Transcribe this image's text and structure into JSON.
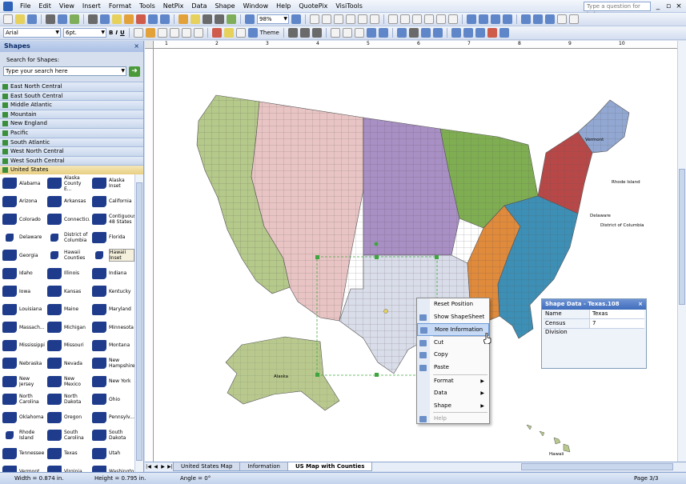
{
  "menubar": {
    "items": [
      "File",
      "Edit",
      "View",
      "Insert",
      "Format",
      "Tools",
      "NetPix",
      "Data",
      "Shape",
      "Window",
      "Help",
      "QuotePix",
      "VisiTools"
    ],
    "help_placeholder": "Type a question for help"
  },
  "toolbar": {
    "zoom": "98%",
    "font": "Arial",
    "font_size": "6pt.",
    "bold": "B",
    "italic": "I",
    "underline": "U",
    "theme_label": "Theme"
  },
  "shapes_panel": {
    "title": "Shapes",
    "search_label": "Search for Shapes:",
    "search_placeholder": "Type your search here",
    "stencils": [
      "East North Central",
      "East South Central",
      "Middle Atlantic",
      "Mountain",
      "New England",
      "Pacific",
      "South Atlantic",
      "West North Central",
      "West South Central",
      "United States"
    ],
    "shapes": [
      [
        "Alabama",
        "Alaska County E...",
        "Alaska Inset"
      ],
      [
        "Arizona",
        "Arkansas",
        "California"
      ],
      [
        "Colorado",
        "Connecticut",
        "Contiguous 48 States"
      ],
      [
        "Delaware",
        "District of Columbia",
        "Florida"
      ],
      [
        "Georgia",
        "Hawaii Counties",
        "Hawaii Inset"
      ],
      [
        "Idaho",
        "Illinois",
        "Indiana"
      ],
      [
        "Iowa",
        "Kansas",
        "Kentucky"
      ],
      [
        "Louisiana",
        "Maine",
        "Maryland"
      ],
      [
        "Massach...",
        "Michigan",
        "Minnesota"
      ],
      [
        "Mississippi",
        "Missouri",
        "Montana"
      ],
      [
        "Nebraska",
        "Nevada",
        "New Hampshire"
      ],
      [
        "New Jersey",
        "New Mexico",
        "New York"
      ],
      [
        "North Carolina",
        "North Dakota",
        "Ohio"
      ],
      [
        "Oklahoma",
        "Oregon",
        "Pennsylv..."
      ],
      [
        "Rhode Island",
        "South Carolina",
        "South Dakota"
      ],
      [
        "Tennessee",
        "Texas",
        "Utah"
      ],
      [
        "Vermont",
        "Virginia",
        "Washington"
      ]
    ]
  },
  "ruler_marks": [
    "1",
    "2",
    "3",
    "4",
    "5",
    "6",
    "7",
    "8",
    "9",
    "10"
  ],
  "map_labels": {
    "vermont": "Vermont",
    "rhode_island": "Rhode Island",
    "delaware": "Delaware",
    "dc": "District of Columbia",
    "alaska": "Alaska",
    "hawaii": "Hawaii"
  },
  "context_menu": {
    "items": [
      {
        "label": "Reset Position",
        "icon": "none",
        "enabled": true,
        "submenu": false
      },
      {
        "label": "Show ShapeSheet",
        "icon": "shapesheet-icon",
        "enabled": true,
        "submenu": false
      },
      {
        "label": "More Information",
        "icon": "info-globe-icon",
        "enabled": true,
        "submenu": false,
        "highlighted": true
      },
      {
        "label": "Cut",
        "icon": "scissors-icon",
        "enabled": true,
        "submenu": false
      },
      {
        "label": "Copy",
        "icon": "copy-icon",
        "enabled": true,
        "submenu": false
      },
      {
        "label": "Paste",
        "icon": "paste-icon",
        "enabled": true,
        "submenu": false
      },
      {
        "label": "Format",
        "icon": "none",
        "enabled": true,
        "submenu": true
      },
      {
        "label": "Data",
        "icon": "none",
        "enabled": true,
        "submenu": true
      },
      {
        "label": "Shape",
        "icon": "none",
        "enabled": true,
        "submenu": true
      },
      {
        "label": "Help",
        "icon": "help-icon",
        "enabled": false,
        "submenu": false
      }
    ]
  },
  "shape_data": {
    "title": "Shape Data - Texas.108",
    "rows": [
      {
        "key": "Name",
        "value": "Texas"
      },
      {
        "key": "Census Division",
        "value": "7"
      }
    ]
  },
  "tabs": [
    "United States Map",
    "Information",
    "US Map with Counties"
  ],
  "active_tab": "US Map with Counties",
  "status": {
    "width": "Width = 0.874 in.",
    "height": "Height = 0.795 in.",
    "angle": "Angle = 0°",
    "page": "Page 3/3"
  },
  "colors": {
    "pacific": "#b5c98a",
    "mountain": "#e9c4c4",
    "west_north_central": "#a88fc4",
    "east_north_central": "#7fae52",
    "west_south_central": "#d9dde9",
    "east_south_central": "#e08a3c",
    "south_atlantic": "#3d8fb5",
    "middle_atlantic": "#b84848",
    "new_england": "#92a8d2",
    "alaska": "#b9c98e",
    "menu_highlight": "#c6d9f5"
  }
}
